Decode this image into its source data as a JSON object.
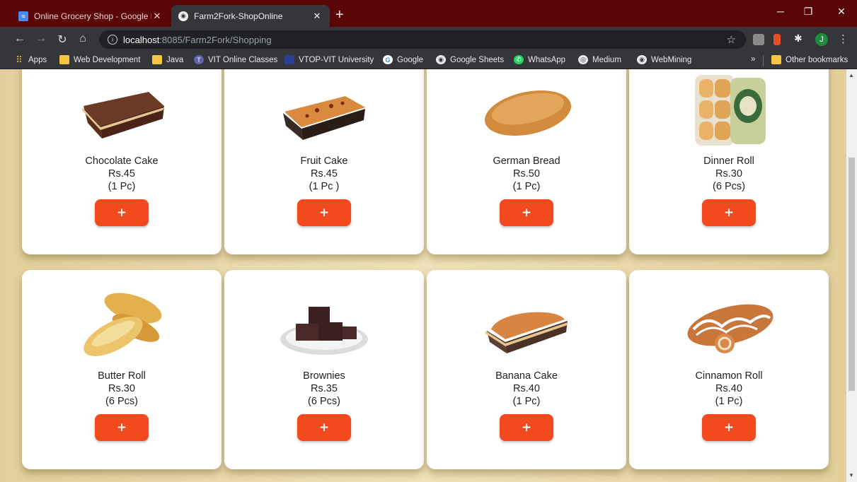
{
  "browser": {
    "tabs": [
      {
        "title": "Online Grocery Shop - Google Do",
        "icon": "docs-icon",
        "active": false
      },
      {
        "title": "Farm2Fork-ShopOnline",
        "icon": "globe-icon",
        "active": true
      }
    ],
    "url_host": "localhost",
    "url_path": ":8085/Farm2Fork/Shopping",
    "profile_initial": "J",
    "bookmarks": [
      {
        "label": "Apps",
        "icon": "apps-icon"
      },
      {
        "label": "Web Development",
        "icon": "folder-icon"
      },
      {
        "label": "Java",
        "icon": "folder-icon"
      },
      {
        "label": "VIT Online Classes",
        "icon": "teams-icon"
      },
      {
        "label": "VTOP-VIT University",
        "icon": "vtop-icon"
      },
      {
        "label": "Google",
        "icon": "google-icon"
      },
      {
        "label": "Google Sheets",
        "icon": "globe-icon"
      },
      {
        "label": "WhatsApp",
        "icon": "whatsapp-icon"
      },
      {
        "label": "Medium",
        "icon": "medium-icon"
      },
      {
        "label": "WebMining",
        "icon": "globe-icon"
      }
    ],
    "bookmarks_overflow": "»",
    "other_bookmarks": "Other bookmarks"
  },
  "products": [
    {
      "name": "Chocolate Cake",
      "price": "Rs.45",
      "qty": "(1 Pc)",
      "button": "+",
      "image": "chocolate-cake"
    },
    {
      "name": "Fruit Cake",
      "price": "Rs.45",
      "qty": "(1 Pc )",
      "button": "+",
      "image": "fruit-cake"
    },
    {
      "name": "German Bread",
      "price": "Rs.50",
      "qty": "(1 Pc)",
      "button": "+",
      "image": "german-bread"
    },
    {
      "name": "Dinner Roll",
      "price": "Rs.30",
      "qty": "(6 Pcs)",
      "button": "+",
      "image": "dinner-roll"
    },
    {
      "name": "Butter Roll",
      "price": "Rs.30",
      "qty": "(6 Pcs)",
      "button": "+",
      "image": "butter-roll"
    },
    {
      "name": "Brownies",
      "price": "Rs.35",
      "qty": "(6 Pcs)",
      "button": "+",
      "image": "brownies"
    },
    {
      "name": "Banana Cake",
      "price": "Rs.40",
      "qty": "(1 Pc)",
      "button": "+",
      "image": "banana-cake"
    },
    {
      "name": "Cinnamon Roll",
      "price": "Rs.40",
      "qty": "(1 Pc)",
      "button": "+",
      "image": "cinnamon-roll"
    }
  ],
  "colors": {
    "tabbar": "#5a0606",
    "add_button": "#f24a1d",
    "page_background": "#e9d6a6"
  }
}
